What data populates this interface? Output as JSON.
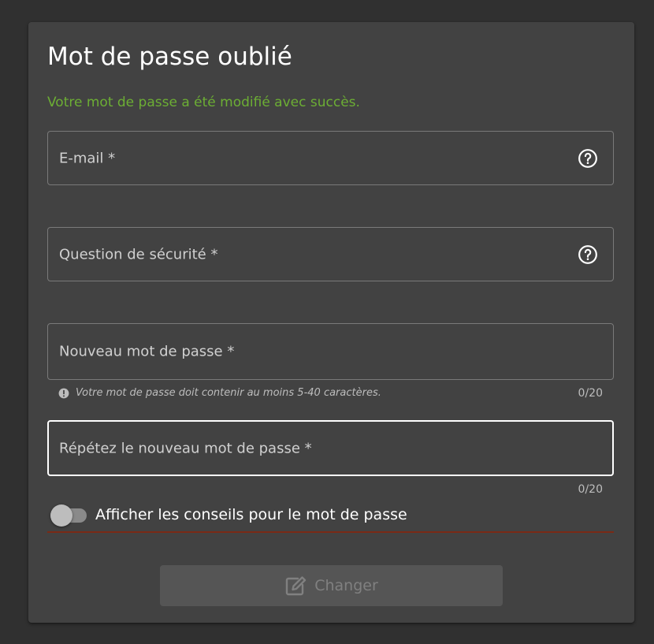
{
  "form": {
    "title": "Mot de passe oublié",
    "success_message": "Votre mot de passe a été modifié avec succès.",
    "email": {
      "label": "E-mail *",
      "value": "",
      "help_icon": "help-circle-icon"
    },
    "security_question": {
      "label": "Question de sécurité *",
      "value": "",
      "help_icon": "help-circle-icon"
    },
    "new_password": {
      "label": "Nouveau mot de passe *",
      "value": "",
      "hint": "Votre mot de passe doit contenir au moins 5-40 caractères.",
      "hint_icon": "info-icon",
      "counter": "0/20"
    },
    "repeat_password": {
      "label": "Répétez le nouveau mot de passe *",
      "value": "",
      "counter": "0/20"
    },
    "show_tips": {
      "label": "Afficher les conseils pour le mot de passe",
      "checked": false
    },
    "submit": {
      "label": "Changer",
      "icon": "edit-icon",
      "disabled": true
    }
  },
  "colors": {
    "background": "#303030",
    "card": "#424242",
    "success": "#6cae34",
    "underline": "#7a2a16"
  }
}
